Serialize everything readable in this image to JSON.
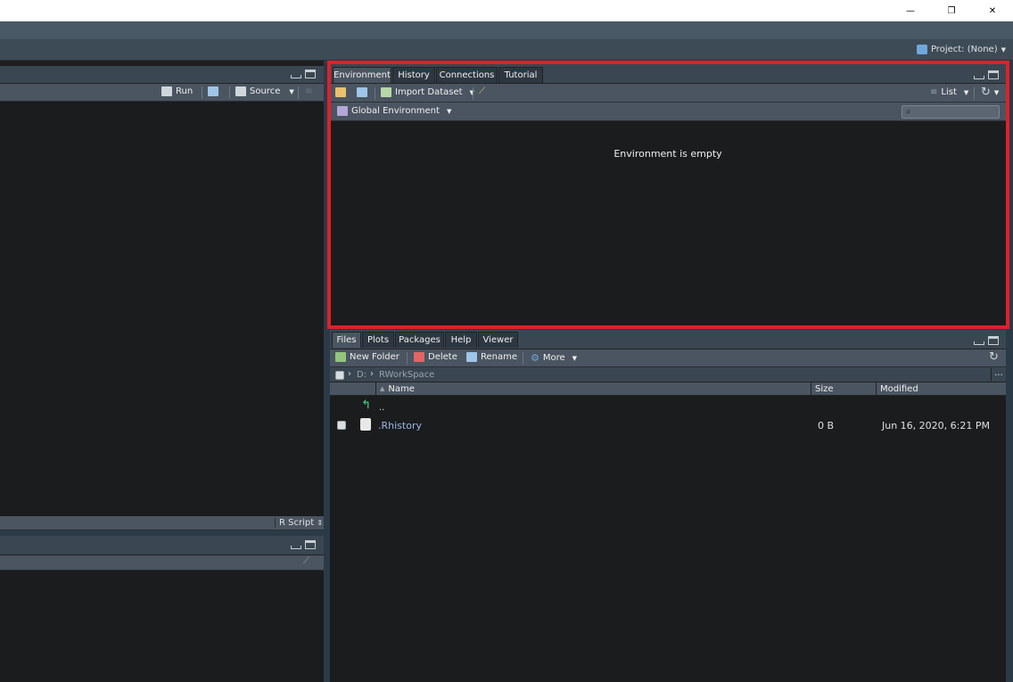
{
  "window": {
    "controls": {
      "minimize": "—",
      "restore": "❐",
      "close": "✕"
    }
  },
  "project": {
    "label": "Project: (None)"
  },
  "source_pane": {
    "toolbar": {
      "run": "Run",
      "source": "Source"
    },
    "status": {
      "file_type": "R Script"
    }
  },
  "environment_pane": {
    "tabs": [
      "Environment",
      "History",
      "Connections",
      "Tutorial"
    ],
    "active_tab": "Environment",
    "toolbar": {
      "import_dataset": "Import Dataset",
      "view_mode": "List"
    },
    "scope": "Global Environment",
    "search": {
      "placeholder": ""
    },
    "empty_message": "Environment is empty"
  },
  "files_pane": {
    "tabs": [
      "Files",
      "Plots",
      "Packages",
      "Help",
      "Viewer"
    ],
    "active_tab": "Files",
    "toolbar": {
      "new_folder": "New Folder",
      "delete": "Delete",
      "rename": "Rename",
      "more": "More"
    },
    "breadcrumb": [
      "D:",
      "RWorkSpace"
    ],
    "more_menu": "...",
    "columns": {
      "name": "Name",
      "size": "Size",
      "modified": "Modified"
    },
    "parent_link": "..",
    "files": [
      {
        "name": ".Rhistory",
        "size": "0 B",
        "modified": "Jun 16, 2020, 6:21 PM"
      }
    ]
  },
  "colors": {
    "highlight": "#e0202a",
    "link": "#9db7e8",
    "background": "#1a1c1e"
  }
}
